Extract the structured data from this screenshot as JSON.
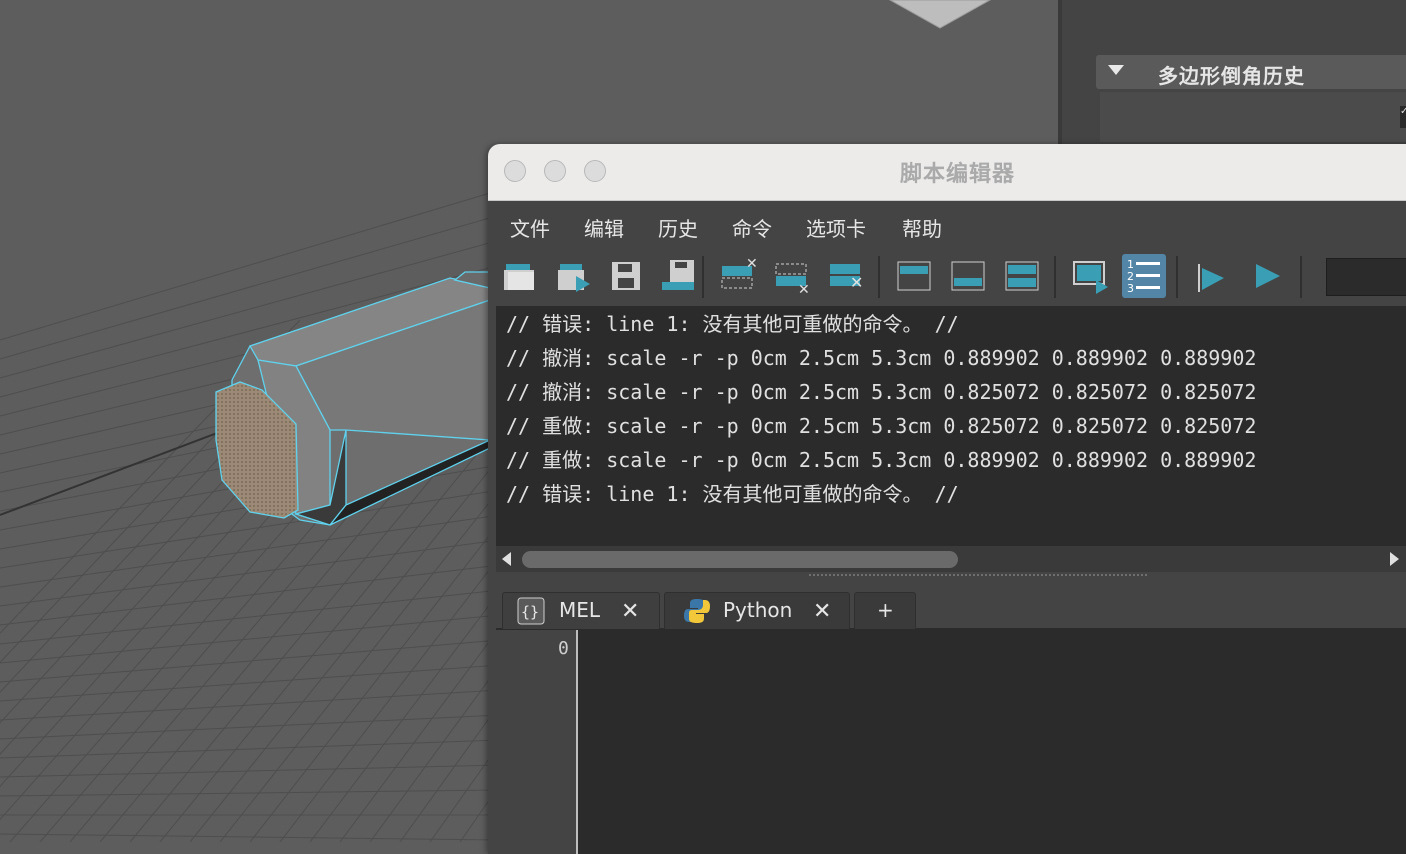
{
  "attribute_editor": {
    "section_title": "多边形倒角历史"
  },
  "window": {
    "title": "脚本编辑器"
  },
  "menu": [
    {
      "label": "文件"
    },
    {
      "label": "编辑"
    },
    {
      "label": "历史"
    },
    {
      "label": "命令"
    },
    {
      "label": "选项卡"
    },
    {
      "label": "帮助"
    }
  ],
  "toolbar": {
    "icons": [
      "open-script-icon",
      "source-script-icon",
      "save-script-icon",
      "save-to-shelf-icon",
      "clear-history-icon",
      "clear-input-icon",
      "clear-all-icon",
      "show-history-only-icon",
      "show-input-only-icon",
      "show-both-icon",
      "echo-all-commands-icon",
      "line-numbers-icon",
      "execute-selected-icon",
      "execute-all-icon"
    ],
    "active": "line-numbers-icon",
    "accent_color": "#3a9fb5"
  },
  "output_lines": [
    "// 错误: line 1: 没有其他可重做的命令。 //",
    "// 撤消: scale -r -p 0cm 2.5cm 5.3cm 0.889902 0.889902 0.889902",
    "// 撤消: scale -r -p 0cm 2.5cm 5.3cm 0.825072 0.825072 0.825072",
    "// 重做: scale -r -p 0cm 2.5cm 5.3cm 0.825072 0.825072 0.825072",
    "// 重做: scale -r -p 0cm 2.5cm 5.3cm 0.889902 0.889902 0.889902",
    "// 错误: line 1: 没有其他可重做的命令。 //"
  ],
  "tabs": [
    {
      "label": "MEL",
      "icon": "mel-braces-icon",
      "close": "✕"
    },
    {
      "label": "Python",
      "icon": "python-logo-icon",
      "close": "✕"
    },
    {
      "label": "+"
    }
  ],
  "input": {
    "line_number": "0"
  }
}
